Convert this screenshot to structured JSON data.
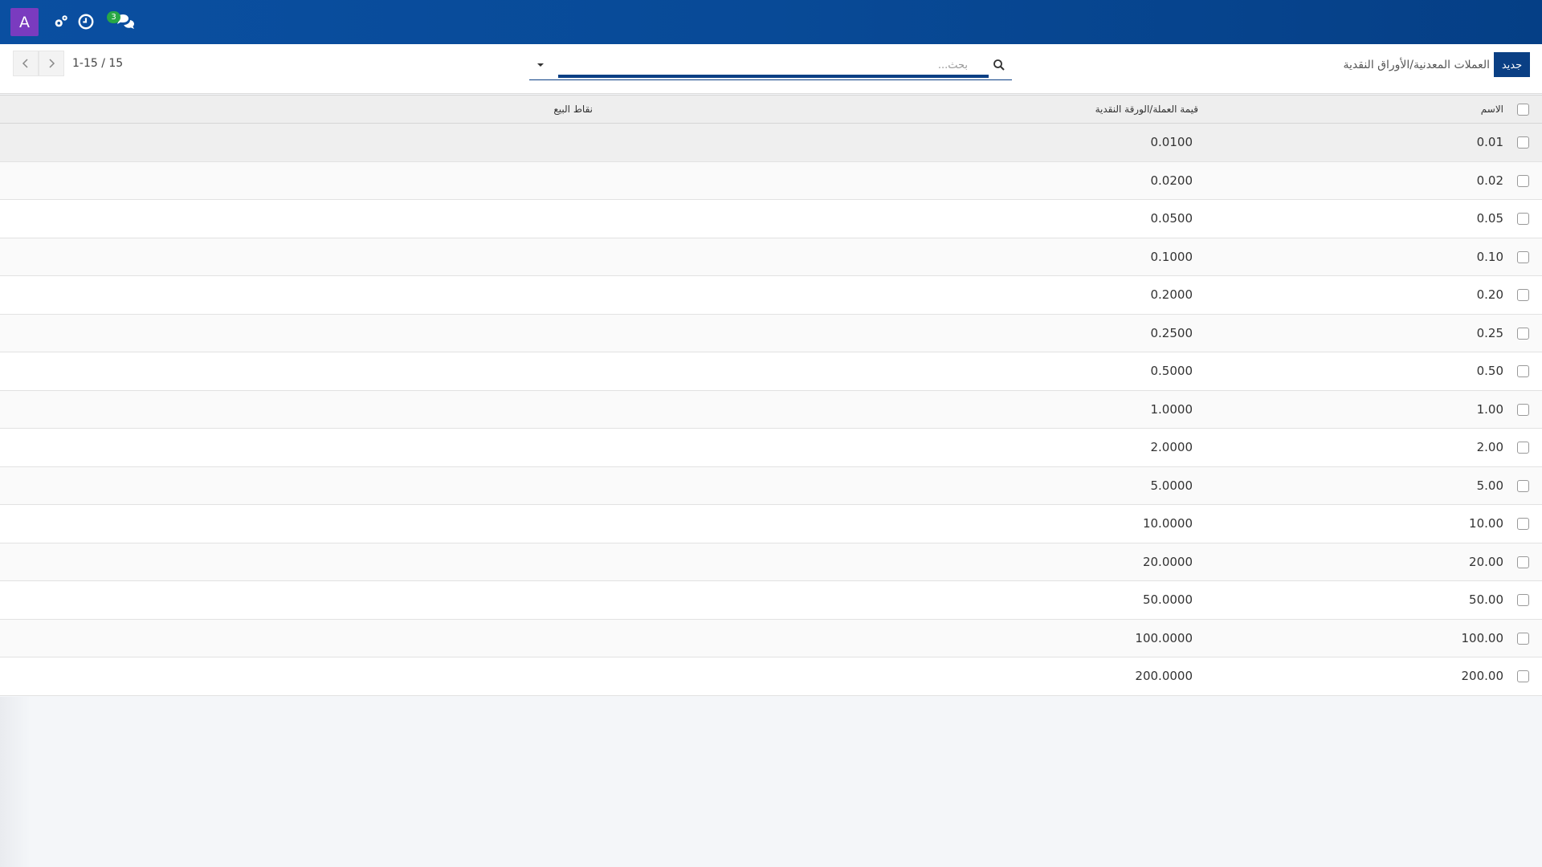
{
  "navbar": {
    "avatar_letter": "A",
    "avatar_color": "#7a3bbf",
    "icons": [
      "settings-cogs-icon",
      "clock-icon",
      "chat-icon"
    ],
    "messages_badge": "3"
  },
  "control_panel": {
    "new_button_label": "جديد",
    "breadcrumb": "العملات المعدنية/الأوراق النقدية",
    "search_placeholder": "بحث...",
    "pager_value": "1-15 / 15"
  },
  "table": {
    "headers": {
      "name": "الاسم",
      "value": "قيمة العملة/الورقة النقدية",
      "pos": "نقاط البيع"
    },
    "rows": [
      {
        "name": "0.01",
        "value": "0.0100"
      },
      {
        "name": "0.02",
        "value": "0.0200"
      },
      {
        "name": "0.05",
        "value": "0.0500"
      },
      {
        "name": "0.10",
        "value": "0.1000"
      },
      {
        "name": "0.20",
        "value": "0.2000"
      },
      {
        "name": "0.25",
        "value": "0.2500"
      },
      {
        "name": "0.50",
        "value": "0.5000"
      },
      {
        "name": "1.00",
        "value": "1.0000"
      },
      {
        "name": "2.00",
        "value": "2.0000"
      },
      {
        "name": "5.00",
        "value": "5.0000"
      },
      {
        "name": "10.00",
        "value": "10.0000"
      },
      {
        "name": "20.00",
        "value": "20.0000"
      },
      {
        "name": "50.00",
        "value": "50.0000"
      },
      {
        "name": "100.00",
        "value": "100.0000"
      },
      {
        "name": "200.00",
        "value": "200.0000"
      }
    ]
  },
  "colors": {
    "navbar": "#084a97",
    "primary": "#0a3f84"
  }
}
